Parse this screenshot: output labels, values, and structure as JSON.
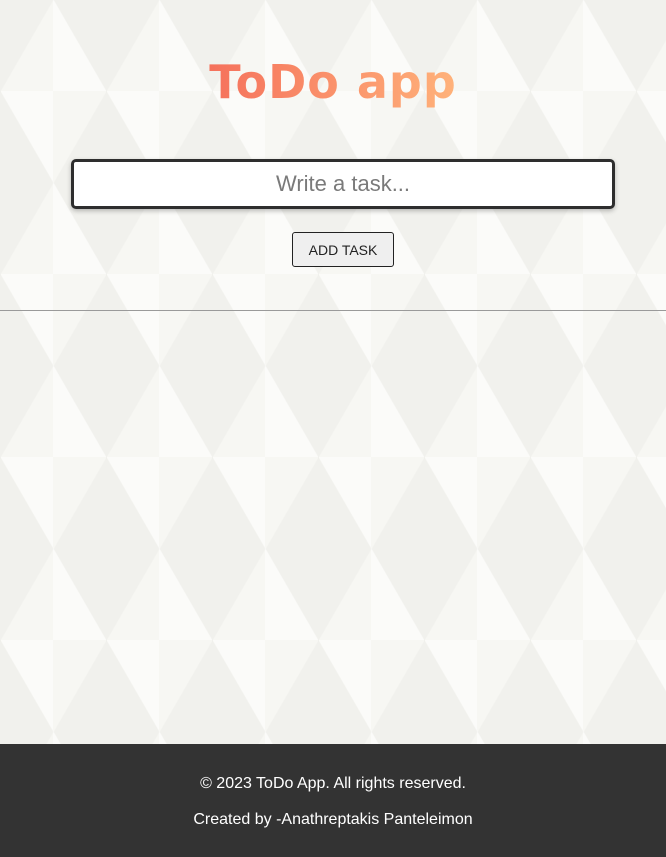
{
  "header": {
    "title": "ToDo app"
  },
  "task_form": {
    "input_placeholder": "Write a task...",
    "input_value": "",
    "add_button_label": "ADD TASK"
  },
  "task_list": {
    "items": []
  },
  "footer": {
    "copyright": "© 2023 ToDo App. All rights reserved.",
    "credit": "Created by -Anathreptakis Panteleimon"
  },
  "colors": {
    "title_gradient_start": "#f5715c",
    "title_gradient_end": "#ffb27a",
    "footer_background": "#333333",
    "page_background": "#f7f7f3"
  }
}
